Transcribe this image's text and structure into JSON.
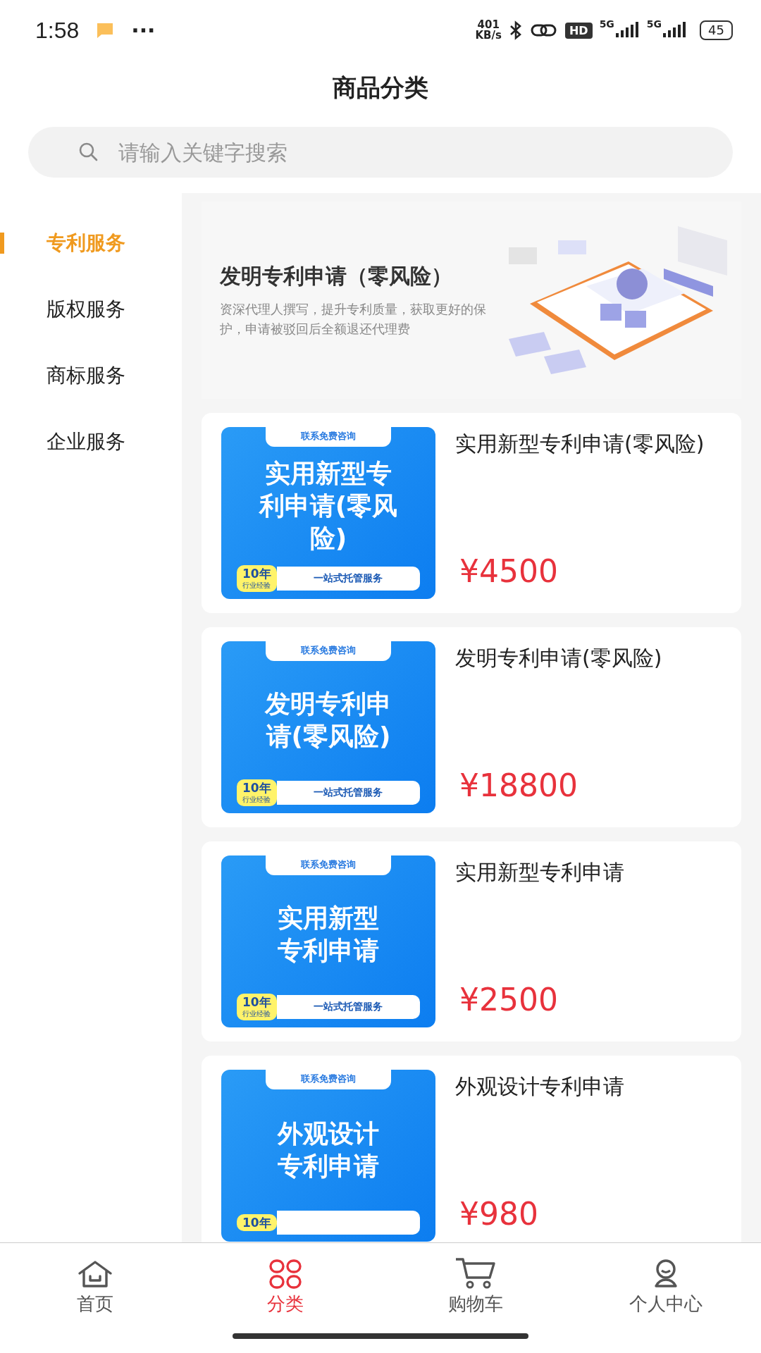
{
  "status_bar": {
    "time": "1:58",
    "dots": "···",
    "speed_value": "401",
    "speed_unit": "KB/s",
    "hd": "HD",
    "network_1": "5G",
    "network_2": "5G",
    "battery": "45"
  },
  "header": {
    "title": "商品分类"
  },
  "search": {
    "placeholder": "请输入关键字搜索"
  },
  "sidebar": {
    "items": [
      {
        "label": "专利服务",
        "selected": true
      },
      {
        "label": "版权服务",
        "selected": false
      },
      {
        "label": "商标服务",
        "selected": false
      },
      {
        "label": "企业服务",
        "selected": false
      }
    ]
  },
  "banner": {
    "title": "发明专利申请（零风险）",
    "description": "资深代理人撰写，提升专利质量，获取更好的保护，申请被驳回后全额退还代理费"
  },
  "products": [
    {
      "name": "实用新型专利申请(零风险)",
      "price": "¥4500",
      "image": {
        "tag": "联系免费咨询",
        "headline": [
          "实用新型专",
          "利申请(零风",
          "险)"
        ],
        "years": "10年",
        "years_caption": "行业经验",
        "service": "一站式托管服务"
      }
    },
    {
      "name": "发明专利申请(零风险)",
      "price": "¥18800",
      "image": {
        "tag": "联系免费咨询",
        "headline": [
          "发明专利申",
          "请(零风险)"
        ],
        "years": "10年",
        "years_caption": "行业经验",
        "service": "一站式托管服务"
      }
    },
    {
      "name": "实用新型专利申请",
      "price": "¥2500",
      "image": {
        "tag": "联系免费咨询",
        "headline": [
          "实用新型",
          "专利申请"
        ],
        "years": "10年",
        "years_caption": "行业经验",
        "service": "一站式托管服务"
      }
    },
    {
      "name": "外观设计专利申请",
      "price": "¥980",
      "image": {
        "tag": "联系免费咨询",
        "headline": [
          "外观设计",
          "专利申请"
        ],
        "years": "10年"
      }
    }
  ],
  "tab_bar": {
    "tabs": [
      {
        "label": "首页",
        "kind": "home",
        "selected": false
      },
      {
        "label": "分类",
        "kind": "category",
        "selected": true
      },
      {
        "label": "购物车",
        "kind": "cart",
        "selected": false
      },
      {
        "label": "个人中心",
        "kind": "profile",
        "selected": false
      }
    ]
  }
}
